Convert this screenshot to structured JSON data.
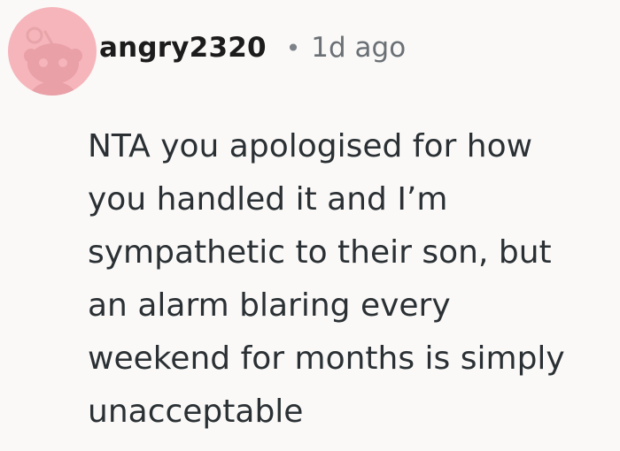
{
  "comment": {
    "avatar_icon": "reddit-snoo-avatar-icon",
    "avatar_color": "#f6b5bb",
    "username": "angry2320",
    "separator": "•",
    "timestamp": "1d ago",
    "body_lines": [
      "NTA you apologised for how",
      "you handled it and I’m",
      "sympathetic to their son, but",
      "an alarm blaring every",
      "weekend for months is simply",
      "unacceptable"
    ]
  }
}
